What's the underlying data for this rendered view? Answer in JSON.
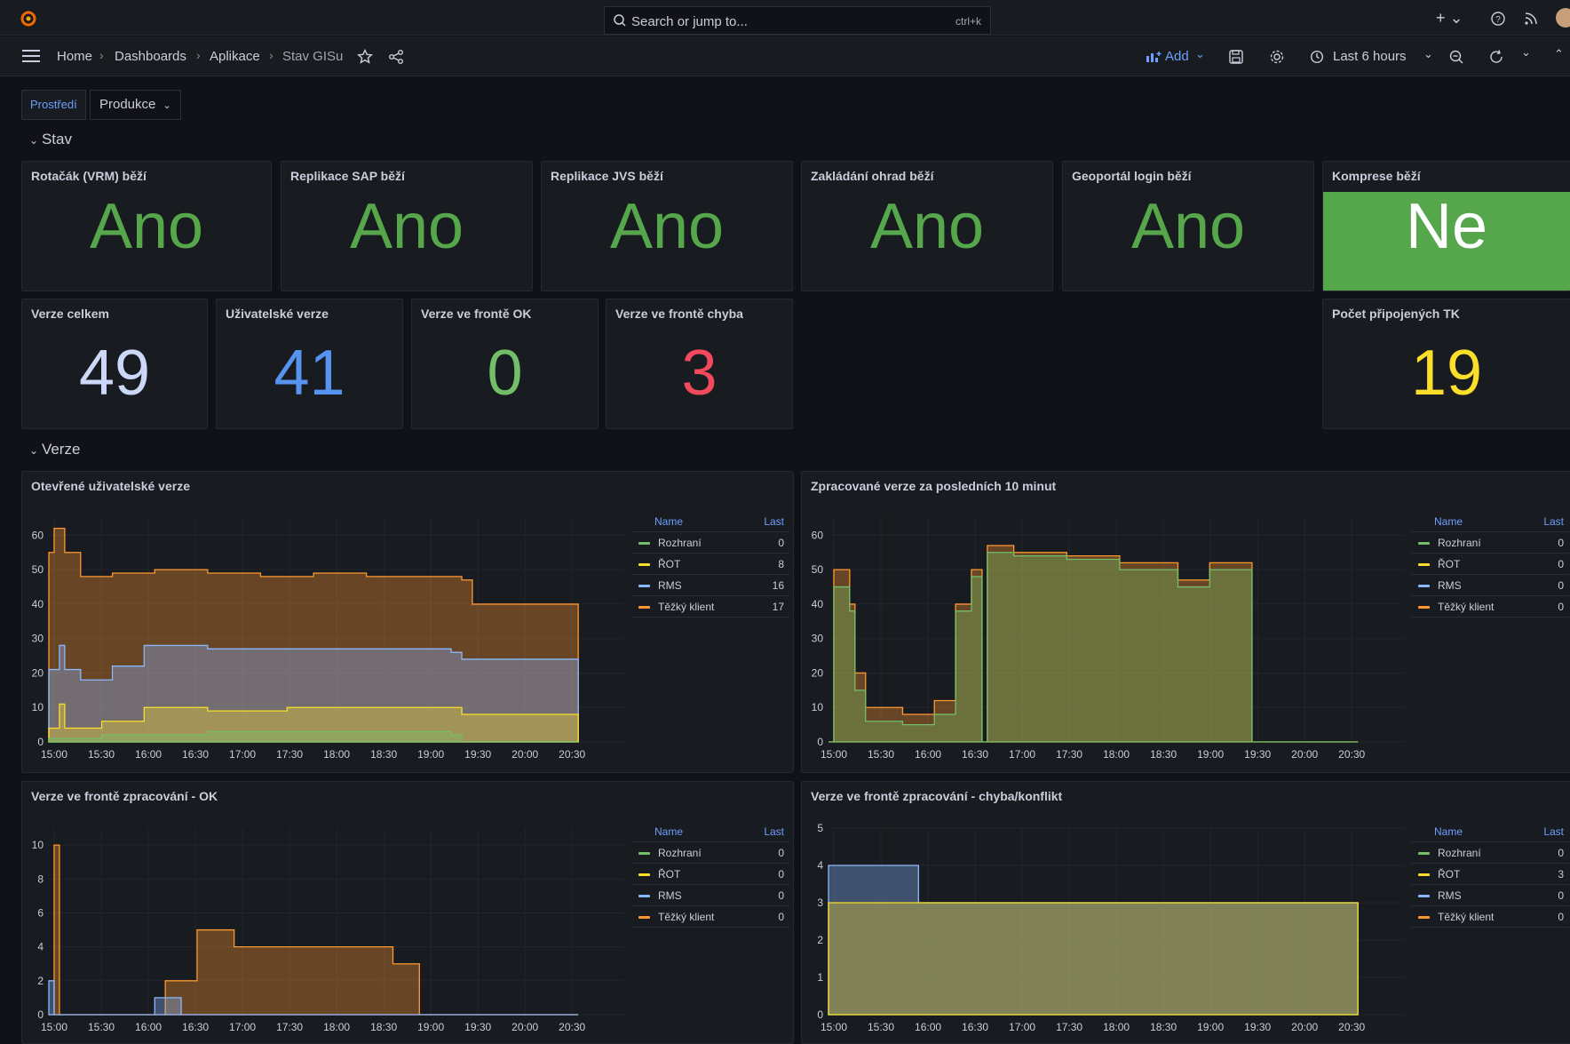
{
  "topbar": {
    "search_placeholder": "Search or jump to...",
    "search_shortcut": "ctrl+k"
  },
  "breadcrumb": [
    "Home",
    "Dashboards",
    "Aplikace",
    "Stav GISu"
  ],
  "toolbar": {
    "add_label": "Add",
    "time_range": "Last 6 hours"
  },
  "variable": {
    "label": "Prostředí",
    "value": "Produkce"
  },
  "rows": {
    "stav": "Stav",
    "verze": "Verze"
  },
  "status_panels": [
    {
      "title": "Rotačák (VRM) běží",
      "value": "Ano",
      "color": "#56a64b"
    },
    {
      "title": "Replikace SAP běží",
      "value": "Ano",
      "color": "#56a64b"
    },
    {
      "title": "Replikace JVS běží",
      "value": "Ano",
      "color": "#56a64b"
    },
    {
      "title": "Zakládání ohrad běží",
      "value": "Ano",
      "color": "#56a64b"
    },
    {
      "title": "Geoportál login běží",
      "value": "Ano",
      "color": "#56a64b"
    },
    {
      "title": "Komprese běží",
      "value": "Ne",
      "color": "#ffffff",
      "background": "#56a64b"
    }
  ],
  "stat_panels": [
    {
      "title": "Verze celkem",
      "value": "49",
      "color": "#cbd8f8"
    },
    {
      "title": "Uživatelské verze",
      "value": "41",
      "color": "#5794f2"
    },
    {
      "title": "Verze ve frontě OK",
      "value": "0",
      "color": "#73bf69"
    },
    {
      "title": "Verze ve frontě chyba",
      "value": "3",
      "color": "#f2495c"
    },
    {
      "title": "Počet připojených TK",
      "value": "19",
      "color": "#fade2a"
    }
  ],
  "series_colors": {
    "Rozhraní": "#73bf69",
    "ŘOT": "#fade2a",
    "RMS": "#8ab8ff",
    "Těžký klient": "#ff9830"
  },
  "legend_header": {
    "name": "Name",
    "last": "Last"
  },
  "chart_data": [
    {
      "type": "area",
      "title": "Otevřené uživatelské verze",
      "x_ticks": [
        "15:00",
        "15:30",
        "16:00",
        "16:30",
        "17:00",
        "17:30",
        "18:00",
        "18:30",
        "19:00",
        "19:30",
        "20:00",
        "20:30"
      ],
      "ylim": [
        0,
        65
      ],
      "y_ticks": [
        0,
        10,
        20,
        30,
        40,
        50,
        60
      ],
      "stacked": true,
      "legend": [
        {
          "name": "Rozhraní",
          "last": "0"
        },
        {
          "name": "ŘOT",
          "last": "8"
        },
        {
          "name": "RMS",
          "last": "16"
        },
        {
          "name": "Těžký klient",
          "last": "17"
        }
      ]
    },
    {
      "type": "area",
      "title": "Zpracované verze za posledních 10 minut",
      "x_ticks": [
        "15:00",
        "15:30",
        "16:00",
        "16:30",
        "17:00",
        "17:30",
        "18:00",
        "18:30",
        "19:00",
        "19:30",
        "20:00",
        "20:30"
      ],
      "ylim": [
        0,
        65
      ],
      "y_ticks": [
        0,
        10,
        20,
        30,
        40,
        50,
        60
      ],
      "stacked": true,
      "legend": [
        {
          "name": "Rozhraní",
          "last": "0"
        },
        {
          "name": "ŘOT",
          "last": "0"
        },
        {
          "name": "RMS",
          "last": "0"
        },
        {
          "name": "Těžký klient",
          "last": "0"
        }
      ]
    },
    {
      "type": "area",
      "title": "Verze ve frontě zpracování - OK",
      "x_ticks": [
        "15:00",
        "15:30",
        "16:00",
        "16:30",
        "17:00",
        "17:30",
        "18:00",
        "18:30",
        "19:00",
        "19:30",
        "20:00",
        "20:30"
      ],
      "ylim": [
        0,
        11
      ],
      "y_ticks": [
        0,
        2,
        4,
        6,
        8,
        10
      ],
      "stacked": true,
      "legend": [
        {
          "name": "Rozhraní",
          "last": "0"
        },
        {
          "name": "ŘOT",
          "last": "0"
        },
        {
          "name": "RMS",
          "last": "0"
        },
        {
          "name": "Těžký klient",
          "last": "0"
        }
      ]
    },
    {
      "type": "area",
      "title": "Verze ve frontě zpracování - chyba/konflikt",
      "x_ticks": [
        "15:00",
        "15:30",
        "16:00",
        "16:30",
        "17:00",
        "17:30",
        "18:00",
        "18:30",
        "19:00",
        "19:30",
        "20:00",
        "20:30"
      ],
      "ylim": [
        0,
        5
      ],
      "y_ticks": [
        0,
        1,
        2,
        3,
        4,
        5
      ],
      "stacked": true,
      "legend": [
        {
          "name": "Rozhraní",
          "last": "0"
        },
        {
          "name": "ŘOT",
          "last": "3"
        },
        {
          "name": "RMS",
          "last": "0"
        },
        {
          "name": "Těžký klient",
          "last": "0"
        }
      ]
    }
  ]
}
